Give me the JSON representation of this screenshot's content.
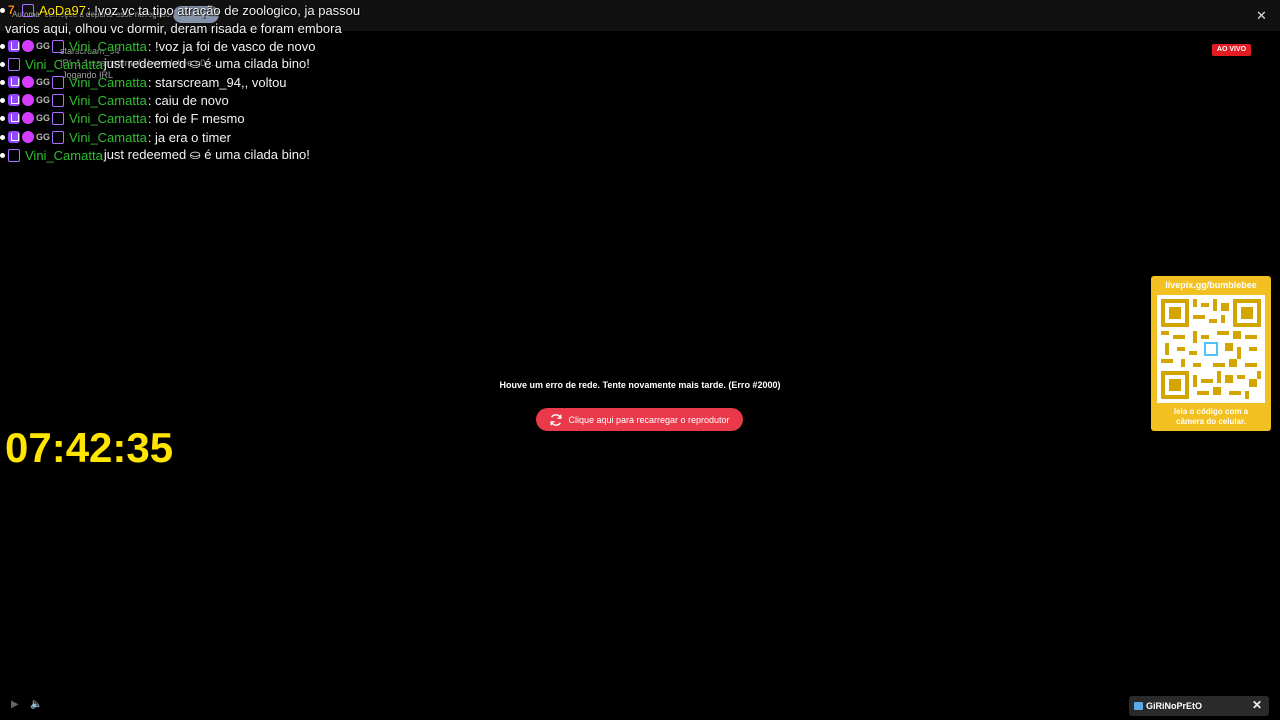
{
  "browser": {
    "debug_notice": "Automa\" começou a depurar esse navegador",
    "cancel_label": "Cancelar",
    "close_glyph": "✕"
  },
  "ghost_overlay": {
    "line1": "starscream_94",
    "line2": "IRL   1 1 assinatura de bumblebee • 0 …",
    "line3": "Jogando IRL"
  },
  "chat": {
    "messages": [
      {
        "user": "AoDa97",
        "text": ": !voz vc ta tipo atração de zoologico, ja passou",
        "cont": "varios aqui, olhou vc dormir, deram risada e foram embora"
      },
      {
        "user": "Vini_Camatta",
        "text": ": !voz ja foi de vasco de novo"
      },
      {
        "user": "Vini_Camatta",
        "text": "just redeemed  ⛀  é uma cilada bino!"
      },
      {
        "user": "Vini_Camatta",
        "text": ": starscream_94,, voltou"
      },
      {
        "user": "Vini_Camatta",
        "text": ": caiu de novo"
      },
      {
        "user": "Vini_Camatta",
        "text": ": foi de F mesmo"
      },
      {
        "user": "Vini_Camatta",
        "text": ": ja era o timer"
      },
      {
        "user": "Vini_Camatta",
        "text": "just redeemed  ⛀  é uma cilada bino!"
      }
    ]
  },
  "player": {
    "live_badge": "AO VIVO",
    "error_message": "Houve um erro de rede. Tente novamente mais tarde. (Erro #2000)",
    "reload_button": "Clique aqui para recarregar o reprodutor"
  },
  "timer": "07:42:35",
  "qr_card": {
    "url": "livepix.gg/bumblebee",
    "caption_line1": "leia o código com a",
    "caption_line2": "câmera do celular."
  },
  "toast": {
    "name": "GiRiNoPrEtO",
    "close_glyph": "✕"
  },
  "colors": {
    "timer": "#ffe500",
    "username_green": "#2fbf2f",
    "username_yellow": "#ffe500",
    "live_badge": "#e31b23",
    "reload_button": "#e9394a",
    "qr_card": "#f2c020"
  }
}
